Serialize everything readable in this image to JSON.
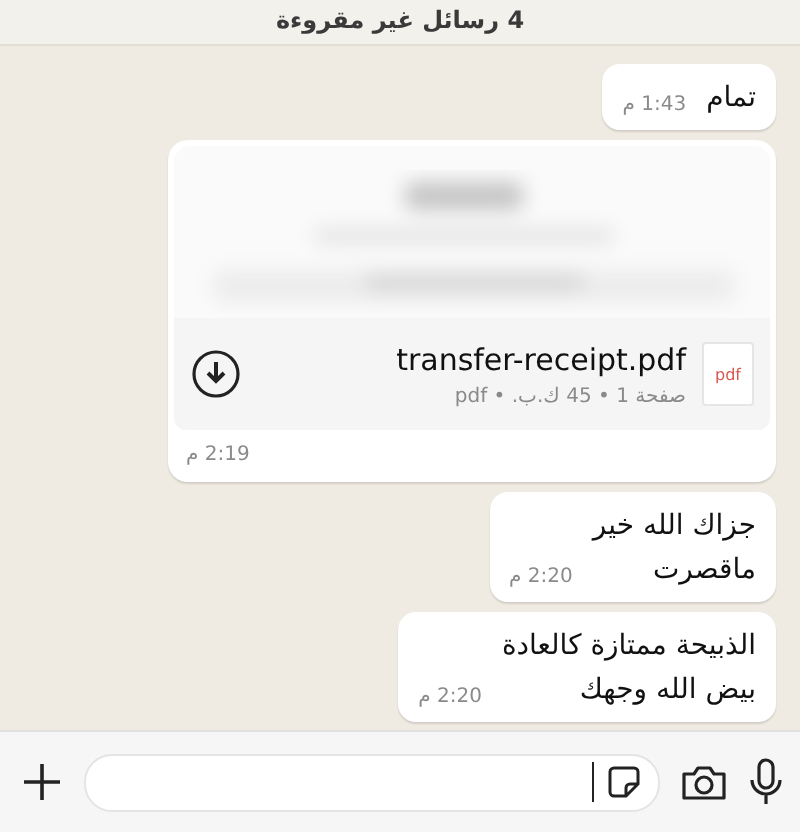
{
  "unread_banner": "4 رسائل غير مقروءة",
  "messages": [
    {
      "kind": "text",
      "text": "تمام",
      "time": "1:43 م"
    },
    {
      "kind": "document",
      "file_icon": "pdf",
      "file_name": "transfer-receipt.pdf",
      "meta": "صفحة 1 • 45 ك.ب. • pdf",
      "time": "2:19 م"
    },
    {
      "kind": "text",
      "text": "جزاك الله خير\nماقصرت",
      "time": "2:20 م"
    },
    {
      "kind": "text",
      "text": "الذبيحة ممتازة كالعادة\nبيض الله وجهك",
      "time": "2:20 م"
    }
  ]
}
